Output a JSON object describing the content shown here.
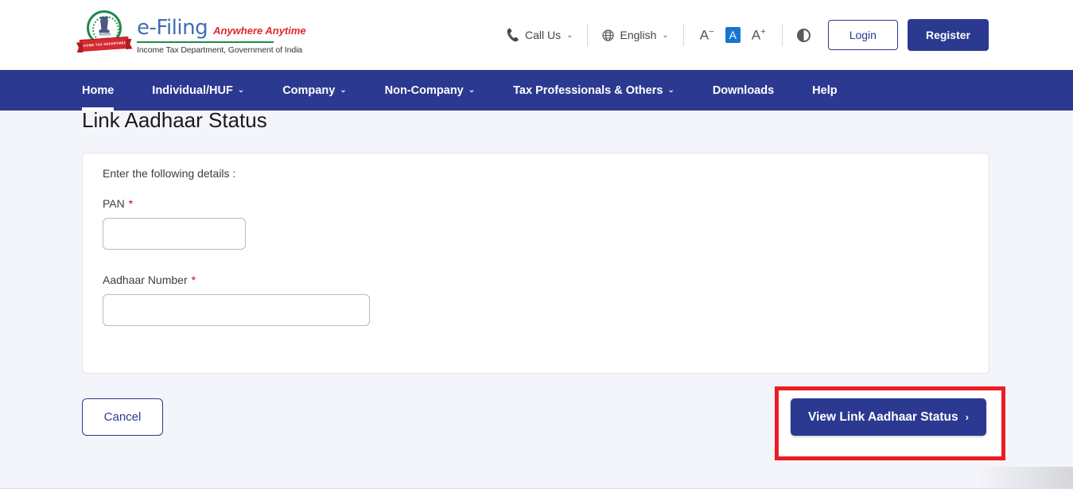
{
  "header": {
    "logo": {
      "emblem_icon": "india-emblem-icon",
      "emblem_ribbon_text": "INCOME TAX DEPARTMENT",
      "emblem_caption": "सत्यमेव जयते",
      "title": "e-Filing",
      "tagline": "Anywhere Anytime",
      "subtitle": "Income Tax Department, Government of India"
    },
    "call_us": {
      "label": "Call Us",
      "icon": "phone-icon",
      "caret": "⌄"
    },
    "language": {
      "label": "English",
      "icon": "globe-icon",
      "caret": "⌄"
    },
    "font_size": {
      "decrease": "A",
      "decrease_sup": "−",
      "normal": "A",
      "increase": "A",
      "increase_sup": "+"
    },
    "contrast": {
      "icon": "contrast-icon"
    },
    "login_label": "Login",
    "register_label": "Register"
  },
  "nav": {
    "items": [
      {
        "label": "Home",
        "has_caret": false,
        "active": true
      },
      {
        "label": "Individual/HUF",
        "has_caret": true,
        "active": false
      },
      {
        "label": "Company",
        "has_caret": true,
        "active": false
      },
      {
        "label": "Non-Company",
        "has_caret": true,
        "active": false
      },
      {
        "label": "Tax Professionals & Others",
        "has_caret": true,
        "active": false
      },
      {
        "label": "Downloads",
        "has_caret": false,
        "active": false
      },
      {
        "label": "Help",
        "has_caret": false,
        "active": false
      }
    ],
    "caret_glyph": "⌄"
  },
  "page": {
    "title": "Link Aadhaar Status",
    "lead": "Enter the following details :",
    "fields": {
      "pan": {
        "label": "PAN",
        "required_mark": "*",
        "value": "",
        "placeholder": ""
      },
      "aadhaar": {
        "label": "Aadhaar Number",
        "required_mark": "*",
        "value": "",
        "placeholder": ""
      }
    },
    "actions": {
      "cancel_label": "Cancel",
      "submit_label": "View Link Aadhaar Status",
      "submit_chevron": "›"
    }
  },
  "colors": {
    "brand_blue": "#2b3990",
    "accent_red": "#ed1c24",
    "required_red": "#d0021b",
    "page_bg": "#f4f5fa",
    "font_active_blue": "#1775d1",
    "green_rule": "#1d8a4a"
  }
}
